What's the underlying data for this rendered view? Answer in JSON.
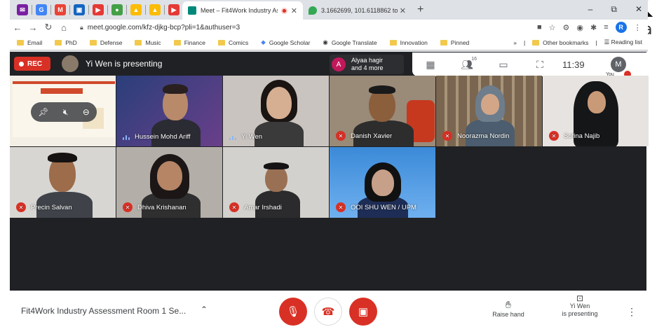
{
  "background_doc": {
    "big_text": "K",
    "na_text": "na",
    "orld_text": "orld"
  },
  "browser": {
    "tabs": [
      {
        "title": "Meet – Fit4Work Industry As",
        "active": true,
        "recording": true
      },
      {
        "title": "3.1662699, 101.6118862 to Wism",
        "active": false
      }
    ],
    "new_tab": "+",
    "window_controls": {
      "minimize": "–",
      "restore": "⧉",
      "close": "✕"
    },
    "url": "meet.google.com/kfz-djkg-bcp?pli=1&authuser=3",
    "profile_initial": "R",
    "bookmarks": [
      "Email",
      "PhD",
      "Defense",
      "Music",
      "Finance",
      "Comics",
      "Google Scholar",
      "Google Translate",
      "Innovation",
      "Pinned"
    ],
    "bookmarks_overflow": "»",
    "other_bookmarks": "Other bookmarks",
    "reading_list": "Reading list"
  },
  "meet": {
    "rec_label": "REC",
    "presenting_text": "Yi Wen is presenting",
    "people_chip": {
      "initial": "A",
      "line1": "Alyaa hagir",
      "line2": "and 4 more"
    },
    "participant_count": "16",
    "time": "11:39",
    "self": {
      "initial": "M",
      "label": "You"
    },
    "participants": [
      {
        "name": "Hussein Mohd Ariff",
        "muted": false
      },
      {
        "name": "Yi Wen",
        "muted": false
      },
      {
        "name": "Danish Xavier",
        "muted": true
      },
      {
        "name": "Noorazma Nordin",
        "muted": true
      },
      {
        "name": "Sofina Najib",
        "muted": true
      },
      {
        "name": "Precin Salvan",
        "muted": true
      },
      {
        "name": "Dhiva Krishanan",
        "muted": true
      },
      {
        "name": "Amar Irshadi",
        "muted": true
      },
      {
        "name": "OOI SHU WEN / UPM",
        "muted": true
      }
    ],
    "meeting_title": "Fit4Work Industry Assessment Room 1 Se...",
    "raise_hand": "Raise hand",
    "presenting_btn_line1": "Yi Wen",
    "presenting_btn_line2": "is presenting"
  },
  "colors": {
    "meet_bg": "#202124",
    "accent_red": "#d93025",
    "chrome_bg": "#dee1e6"
  }
}
